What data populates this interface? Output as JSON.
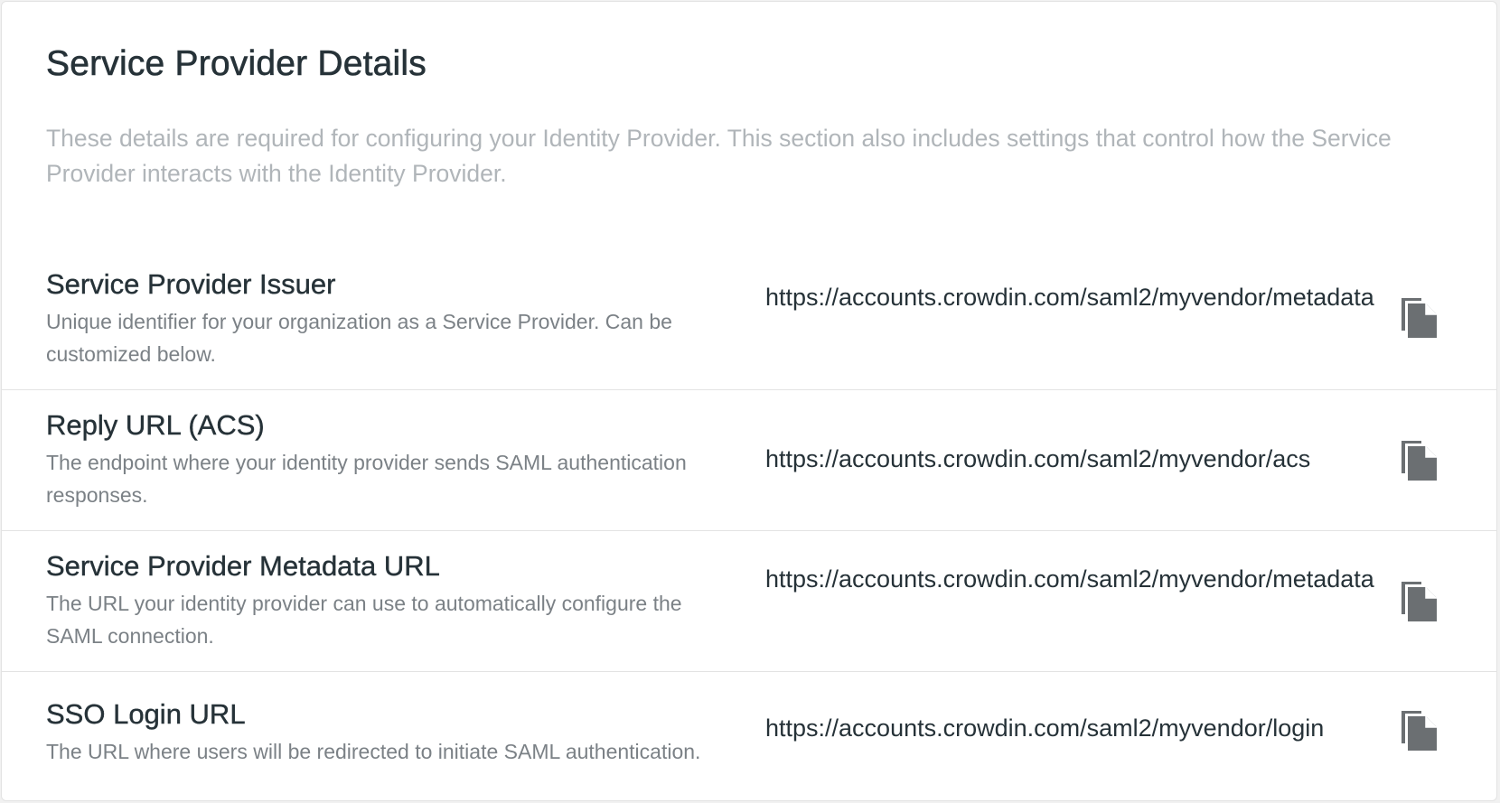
{
  "section": {
    "title": "Service Provider Details",
    "description": "These details are required for configuring your Identity Provider. This section also includes settings that control how the Service Provider interacts with the Identity Provider."
  },
  "rows": [
    {
      "title": "Service Provider Issuer",
      "description": "Unique identifier for your organization as a Service Provider. Can be customized below.",
      "value": "https://accounts.crowdin.com/saml2/myvendor/metadata",
      "copy_icon": "copy-icon"
    },
    {
      "title": "Reply URL (ACS)",
      "description": "The endpoint where your identity provider sends SAML authentication responses.",
      "value": "https://accounts.crowdin.com/saml2/myvendor/acs",
      "copy_icon": "copy-icon"
    },
    {
      "title": "Service Provider Metadata URL",
      "description": "The URL your identity provider can use to automatically configure the SAML connection.",
      "value": "https://accounts.crowdin.com/saml2/myvendor/metadata",
      "copy_icon": "copy-icon"
    },
    {
      "title": "SSO Login URL",
      "description": "The URL where users will be redirected to initiate SAML authentication.",
      "value": "https://accounts.crowdin.com/saml2/myvendor/login",
      "copy_icon": "copy-icon"
    }
  ],
  "colors": {
    "title_text": "#263238",
    "muted_text": "#b0b5b9",
    "description_text": "#7b8186",
    "icon": "#6b6f72",
    "divider": "#e3e3e3"
  }
}
